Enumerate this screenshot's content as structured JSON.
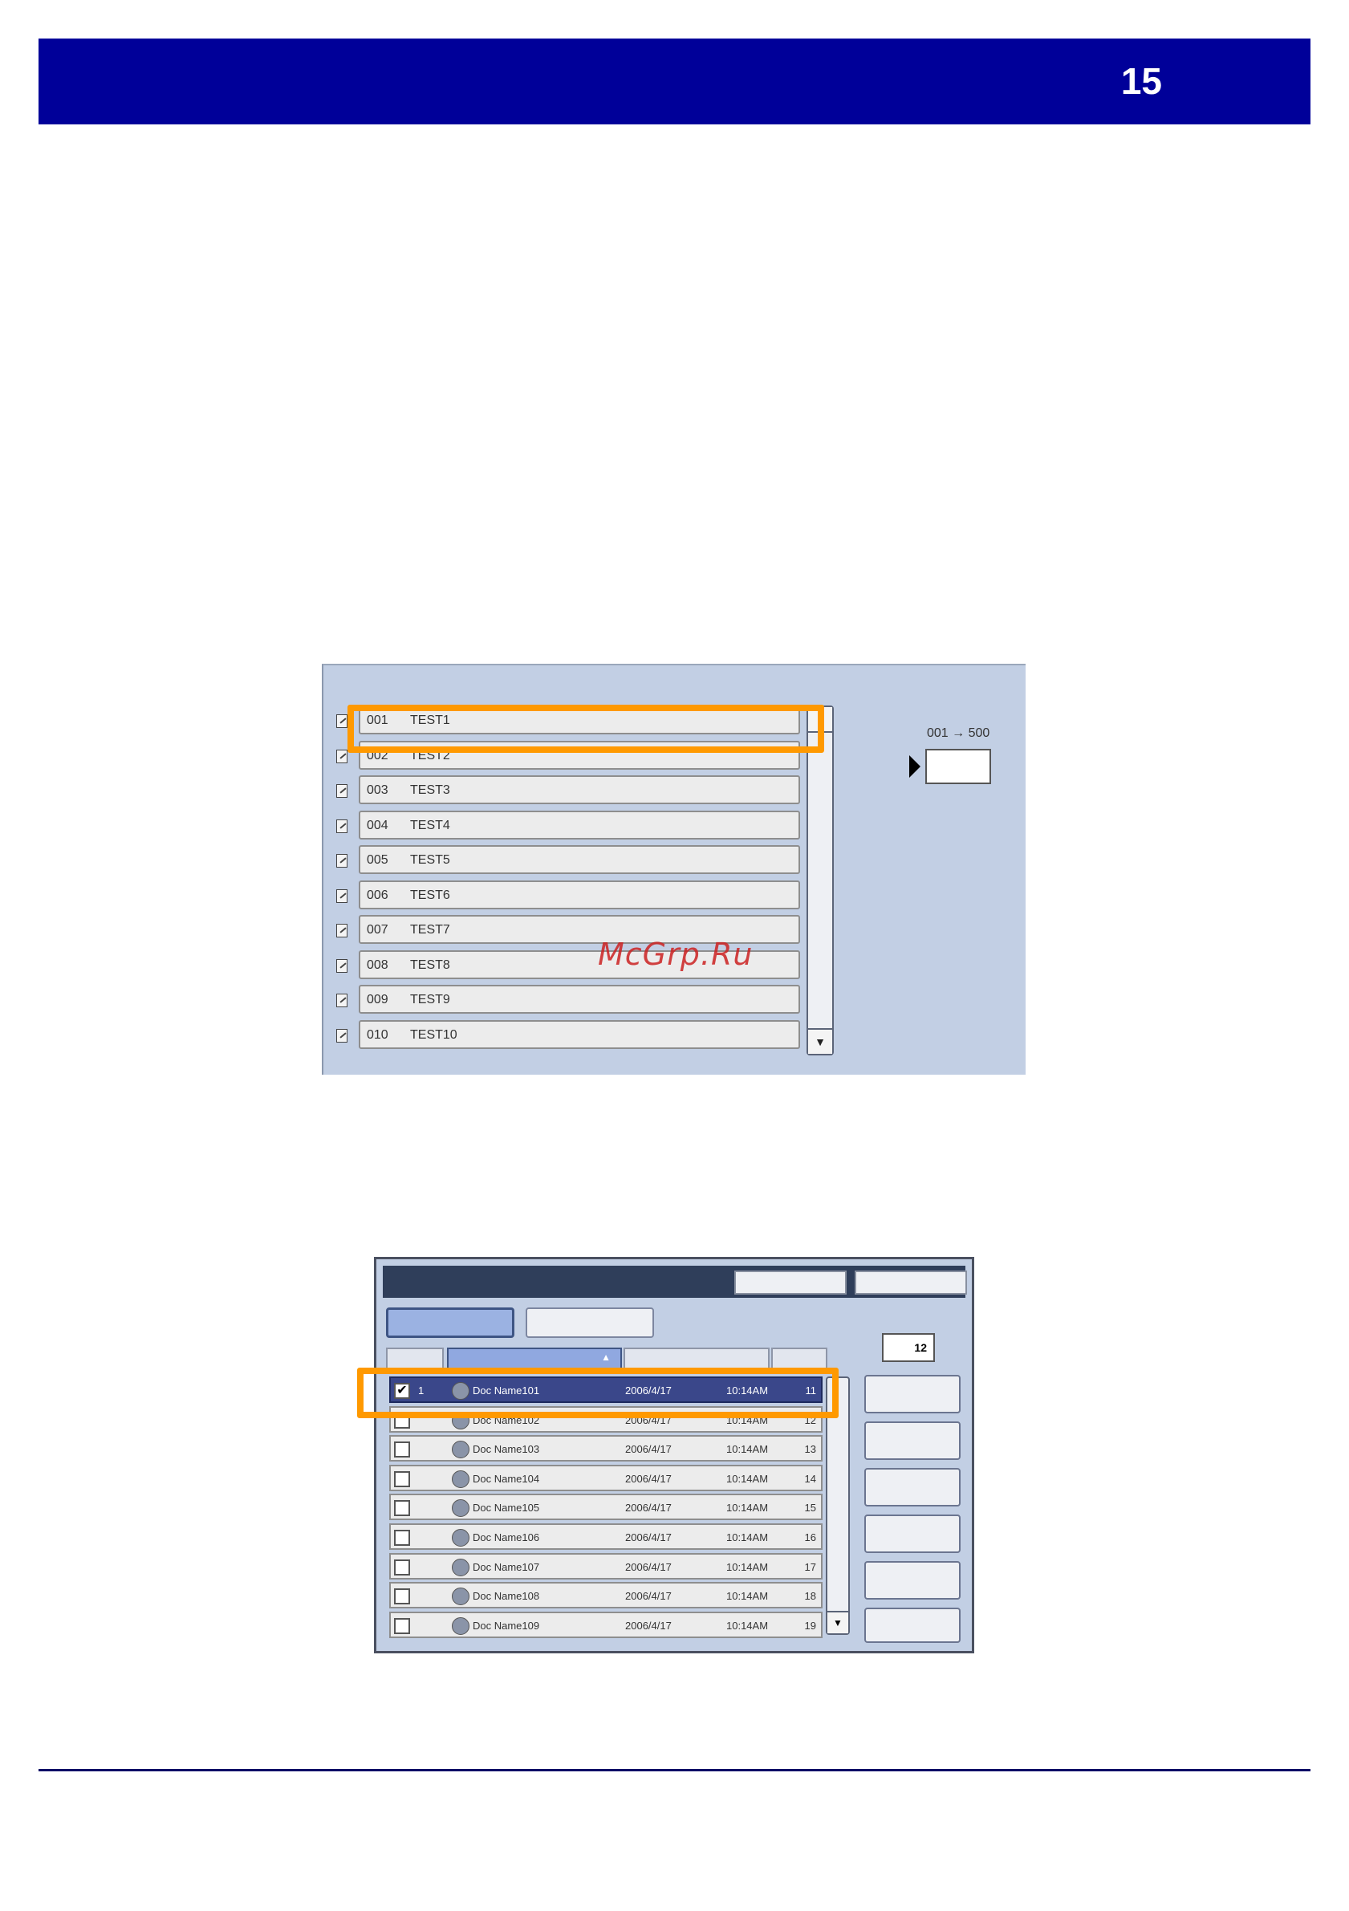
{
  "header": {
    "page_number": "15",
    "bar_color": "#000099"
  },
  "watermark": {
    "text": "McGrp.Ru"
  },
  "mailbox_list": {
    "range_label": "001 → 500",
    "range_value": "",
    "rows": [
      {
        "num": "001",
        "name": "TEST1"
      },
      {
        "num": "002",
        "name": "TEST2"
      },
      {
        "num": "003",
        "name": "TEST3"
      },
      {
        "num": "004",
        "name": "TEST4"
      },
      {
        "num": "005",
        "name": "TEST5"
      },
      {
        "num": "006",
        "name": "TEST6"
      },
      {
        "num": "007",
        "name": "TEST7"
      },
      {
        "num": "008",
        "name": "TEST8"
      },
      {
        "num": "009",
        "name": "TEST9"
      },
      {
        "num": "010",
        "name": "TEST10"
      }
    ],
    "scroll_down_icon": "chevron-down-icon",
    "highlight_color": "#ff9900"
  },
  "document_list": {
    "count": "12",
    "rows": [
      {
        "checked": true,
        "index": "1",
        "name": "Doc Name101",
        "date": "2006/4/17",
        "time": "10:14AM",
        "pages": "11"
      },
      {
        "checked": false,
        "index": "",
        "name": "Doc Name102",
        "date": "2006/4/17",
        "time": "10:14AM",
        "pages": "12"
      },
      {
        "checked": false,
        "index": "",
        "name": "Doc Name103",
        "date": "2006/4/17",
        "time": "10:14AM",
        "pages": "13"
      },
      {
        "checked": false,
        "index": "",
        "name": "Doc Name104",
        "date": "2006/4/17",
        "time": "10:14AM",
        "pages": "14"
      },
      {
        "checked": false,
        "index": "",
        "name": "Doc Name105",
        "date": "2006/4/17",
        "time": "10:14AM",
        "pages": "15"
      },
      {
        "checked": false,
        "index": "",
        "name": "Doc Name106",
        "date": "2006/4/17",
        "time": "10:14AM",
        "pages": "16"
      },
      {
        "checked": false,
        "index": "",
        "name": "Doc Name107",
        "date": "2006/4/17",
        "time": "10:14AM",
        "pages": "17"
      },
      {
        "checked": false,
        "index": "",
        "name": "Doc Name108",
        "date": "2006/4/17",
        "time": "10:14AM",
        "pages": "18"
      },
      {
        "checked": false,
        "index": "",
        "name": "Doc Name109",
        "date": "2006/4/17",
        "time": "10:14AM",
        "pages": "19"
      }
    ],
    "selected_row_color": "#3a478a",
    "highlight_color": "#ff9900"
  }
}
